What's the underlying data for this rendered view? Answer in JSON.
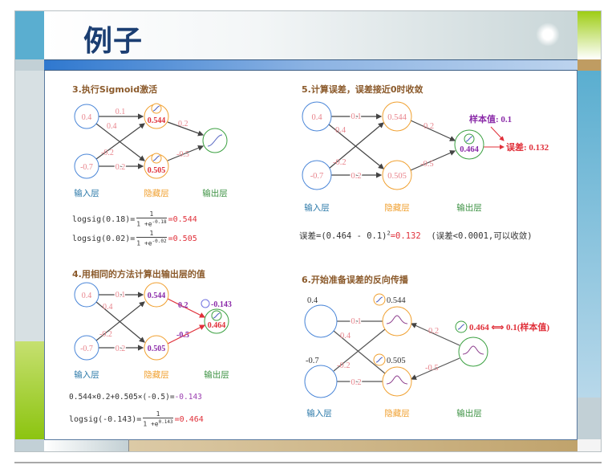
{
  "slide": {
    "title": "例子"
  },
  "layers": {
    "input": "输入层",
    "hidden": "隐藏层",
    "output": "输出层"
  },
  "panel3": {
    "title": "3.执行Sigmoid激活",
    "inputs": [
      "0.4",
      "-0.7"
    ],
    "weights": {
      "w11": "0.1",
      "w12": "0.4",
      "w21": "-0.2",
      "w22": "0.2",
      "v1": "0.2",
      "v2": "-0.5"
    },
    "hidden": [
      "0.544",
      "0.505"
    ],
    "formula1": {
      "lhs": "logsig(0.18)=",
      "num": "1",
      "den": "1 +e",
      "exp": "-0.18",
      "result": "=0.544"
    },
    "formula2": {
      "lhs": "logsig(0.02)=",
      "num": "1",
      "den": "1 +e",
      "exp": "-0.02",
      "result": "=0.505"
    }
  },
  "panel4": {
    "title": "4.用相同的方法计算出输出层的值",
    "inputs": [
      "0.4",
      "-0.7"
    ],
    "weights": {
      "w11": "0.1",
      "w12": "0.4",
      "w21": "-0.2",
      "w22": "0.2",
      "v1": "0.2",
      "v2": "-0.5"
    },
    "hidden": [
      "0.544",
      "0.505"
    ],
    "sum_value": "-0.143",
    "output": "0.464",
    "formula1": {
      "lhs": "0.544×0.2+0.505×(-0.5)=",
      "result": "-0.143"
    },
    "formula2": {
      "lhs": "logsig(-0.143)=",
      "num": "1",
      "den": "1 +e",
      "exp": "0.143",
      "result": "=0.464"
    }
  },
  "panel5": {
    "title": "5.计算误差，误差接近0时收敛",
    "inputs": [
      "0.4",
      "-0.7"
    ],
    "weights": {
      "w11": "0.1",
      "w12": "0.4",
      "w21": "-0.2",
      "w22": "0.2",
      "v1": "0.2",
      "v2": "-0.5"
    },
    "hidden": [
      "0.544",
      "0.505"
    ],
    "output": "0.464",
    "sample_label": "样本值: 0.1",
    "error_label": "误差: 0.132",
    "formula": {
      "lhs": "误差=(0.464 - 0.1)",
      "sup": "2",
      "result": "=0.132",
      "note": "(误差<0.0001,可以收敛)"
    }
  },
  "panel6": {
    "title": "6.开始准备误差的反向传播",
    "inputs": [
      "0.4",
      "-0.7"
    ],
    "weights": {
      "w11": "0.1",
      "w12": "0.4",
      "w21": "-0.2",
      "w22": "0.2",
      "v1": "0.2",
      "v2": "-0.5"
    },
    "hidden": [
      "0.544",
      "0.505"
    ],
    "compare": "0.464 ⟺ 0.1(样本值)"
  },
  "colors": {
    "input": "#4a86d8",
    "hidden": "#f0a030",
    "output": "#3aa040",
    "weight": "#e8848c",
    "red": "#e0303a",
    "purple": "#8a2aa8",
    "title": "#1b3e72"
  }
}
